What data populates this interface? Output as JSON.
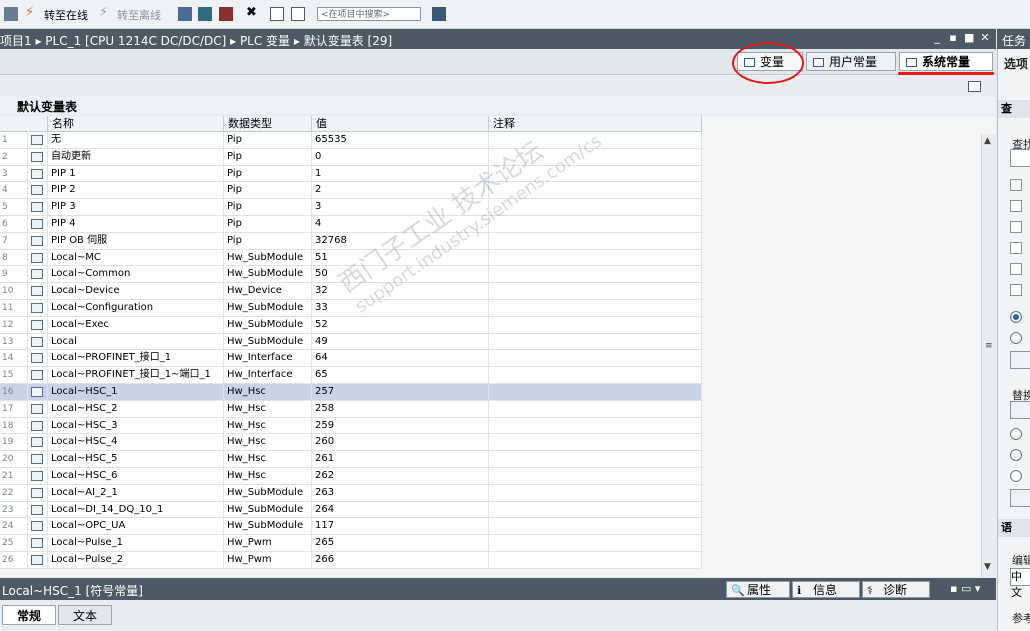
{
  "toolbar": {
    "go_online": "转至在线",
    "go_offline": "转至离线",
    "search_placeholder": "<在项目中搜索>"
  },
  "breadcrumb": {
    "text": "项目1 ▸ PLC_1 [CPU 1214C DC/DC/DC] ▸ PLC 变量 ▸ 默认变量表 [29]"
  },
  "task_panel": {
    "title": "任务",
    "options": "选项",
    "find_section": "查",
    "find_label": "查找",
    "replace_label": "替换",
    "lang_section": "语",
    "edit_label": "编辑",
    "lang_value": "中文",
    "ref_label": "参考"
  },
  "tabs": {
    "variables": "变量",
    "user_constants": "用户常量",
    "system_constants": "系统常量"
  },
  "table": {
    "title": "默认变量表",
    "columns": [
      "名称",
      "数据类型",
      "值",
      "注释"
    ],
    "rows": [
      {
        "num": "1",
        "name": "无",
        "type": "Pip",
        "value": "65535"
      },
      {
        "num": "2",
        "name": "自动更新",
        "type": "Pip",
        "value": "0"
      },
      {
        "num": "3",
        "name": "PIP 1",
        "type": "Pip",
        "value": "1"
      },
      {
        "num": "4",
        "name": "PIP 2",
        "type": "Pip",
        "value": "2"
      },
      {
        "num": "5",
        "name": "PIP 3",
        "type": "Pip",
        "value": "3"
      },
      {
        "num": "6",
        "name": "PIP 4",
        "type": "Pip",
        "value": "4"
      },
      {
        "num": "7",
        "name": "PIP OB 伺服",
        "type": "Pip",
        "value": "32768"
      },
      {
        "num": "8",
        "name": "Local~MC",
        "type": "Hw_SubModule",
        "value": "51"
      },
      {
        "num": "9",
        "name": "Local~Common",
        "type": "Hw_SubModule",
        "value": "50"
      },
      {
        "num": "10",
        "name": "Local~Device",
        "type": "Hw_Device",
        "value": "32"
      },
      {
        "num": "11",
        "name": "Local~Configuration",
        "type": "Hw_SubModule",
        "value": "33"
      },
      {
        "num": "12",
        "name": "Local~Exec",
        "type": "Hw_SubModule",
        "value": "52"
      },
      {
        "num": "13",
        "name": "Local",
        "type": "Hw_SubModule",
        "value": "49"
      },
      {
        "num": "14",
        "name": "Local~PROFINET_接口_1",
        "type": "Hw_Interface",
        "value": "64"
      },
      {
        "num": "15",
        "name": "Local~PROFINET_接口_1~端口_1",
        "type": "Hw_Interface",
        "value": "65"
      },
      {
        "num": "16",
        "name": "Local~HSC_1",
        "type": "Hw_Hsc",
        "value": "257",
        "selected": true
      },
      {
        "num": "17",
        "name": "Local~HSC_2",
        "type": "Hw_Hsc",
        "value": "258"
      },
      {
        "num": "18",
        "name": "Local~HSC_3",
        "type": "Hw_Hsc",
        "value": "259"
      },
      {
        "num": "19",
        "name": "Local~HSC_4",
        "type": "Hw_Hsc",
        "value": "260"
      },
      {
        "num": "20",
        "name": "Local~HSC_5",
        "type": "Hw_Hsc",
        "value": "261"
      },
      {
        "num": "21",
        "name": "Local~HSC_6",
        "type": "Hw_Hsc",
        "value": "262"
      },
      {
        "num": "22",
        "name": "Local~AI_2_1",
        "type": "Hw_SubModule",
        "value": "263"
      },
      {
        "num": "23",
        "name": "Local~DI_14_DQ_10_1",
        "type": "Hw_SubModule",
        "value": "264"
      },
      {
        "num": "24",
        "name": "Local~OPC_UA",
        "type": "Hw_SubModule",
        "value": "117"
      },
      {
        "num": "25",
        "name": "Local~Pulse_1",
        "type": "Hw_Pwm",
        "value": "265"
      },
      {
        "num": "26",
        "name": "Local~Pulse_2",
        "type": "Hw_Pwm",
        "value": "266"
      }
    ]
  },
  "inspector": {
    "title": "Local~HSC_1 [符号常量]",
    "properties": "属性",
    "info": "信息",
    "diagnostics": "诊断",
    "tab_general": "常规",
    "tab_text": "文本"
  },
  "watermark": {
    "line1": "西门子工业  技术论坛",
    "line2": "support.industry.siemens.com/cs"
  }
}
